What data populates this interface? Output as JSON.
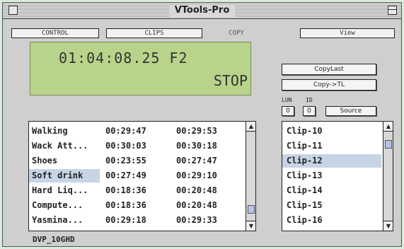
{
  "window": {
    "title": "VTools-Pro"
  },
  "tabs": [
    {
      "label": "CONTROL"
    },
    {
      "label": "CLIPS"
    },
    {
      "label": "COPY"
    },
    {
      "label": "View"
    }
  ],
  "lcd": {
    "timecode": "01:04:08.25 F2",
    "status": "STOP"
  },
  "right_panel": {
    "copy_last_label": "CopyLast",
    "copy_tl_label": "Copy->TL",
    "lun_label": "LUN",
    "id_label": "ID",
    "lun_value": "0",
    "id_value": "0",
    "source_label": "Source"
  },
  "clip_table": {
    "rows": [
      {
        "name": "Walking",
        "in": "00:29:47",
        "out": "00:29:53"
      },
      {
        "name": "Wack Att...",
        "in": "00:30:03",
        "out": "00:30:18"
      },
      {
        "name": "Shoes",
        "in": "00:23:55",
        "out": "00:27:47"
      },
      {
        "name": "Soft drink",
        "in": "00:27:49",
        "out": "00:29:10"
      },
      {
        "name": "Hard Liq...",
        "in": "00:18:36",
        "out": "00:20:48"
      },
      {
        "name": "Compute...",
        "in": "00:18:36",
        "out": "00:20:48"
      },
      {
        "name": "Yasmina...",
        "in": "00:29:18",
        "out": "00:29:33"
      }
    ],
    "selected_index": 3
  },
  "clip_list": {
    "items": [
      "Clip-10",
      "Clip-11",
      "Clip-12",
      "Clip-13",
      "Clip-14",
      "Clip-15",
      "Clip-16"
    ],
    "selected_index": 2
  },
  "footer": {
    "disk_name": "DVP_10GHD"
  }
}
